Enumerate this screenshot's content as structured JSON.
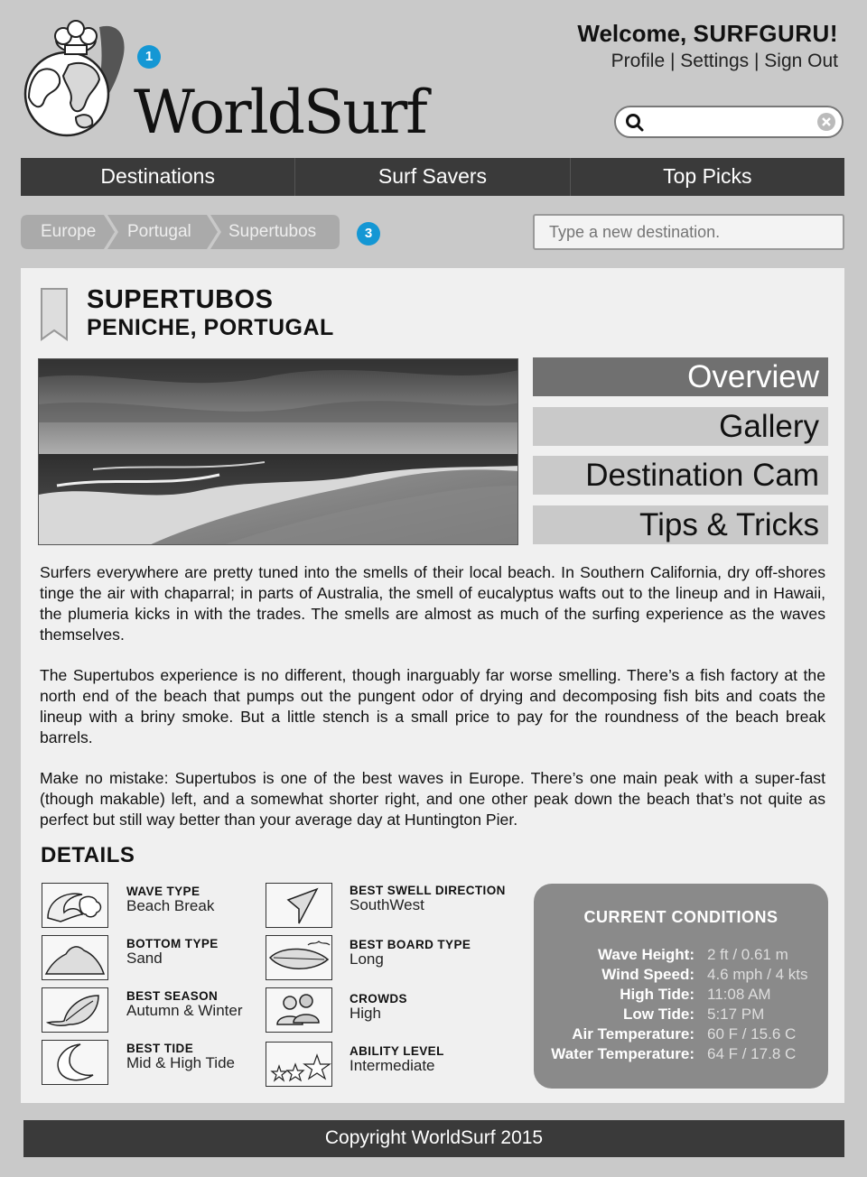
{
  "header": {
    "logo_text": "WorldSurf",
    "badge_1": "1",
    "welcome_prefix": "Welcome, ",
    "username": "SURFGURU!",
    "links": [
      "Profile",
      "Settings",
      "Sign Out"
    ],
    "link_separator": " | "
  },
  "nav": [
    "Destinations",
    "Surf Savers",
    "Top Picks"
  ],
  "breadcrumb": {
    "items": [
      "Europe",
      "Portugal",
      "Supertubos"
    ],
    "badge_3": "3"
  },
  "destination_input": {
    "placeholder": "Type a new destination."
  },
  "spot": {
    "name": "SUPERTUBOS",
    "location": "PENICHE, PORTUGAL"
  },
  "tabs": [
    "Overview",
    "Gallery",
    "Destination Cam",
    "Tips & Tricks"
  ],
  "active_tab": "Overview",
  "description": [
    "Surfers everywhere are pretty tuned into the smells of their local beach. In Southern California, dry off-shores tinge the air with chaparral; in parts of Australia, the smell of eucalyptus wafts out to the lineup and in Hawaii, the plumeria kicks in with the trades. The smells are almost as much of the surfing experience as the waves themselves.",
    "The Supertubos experience is no different, though inarguably far worse smelling. There’s a fish factory at the north end of the beach that pumps out the pungent odor of drying and decomposing fish bits and coats the lineup with a briny smoke. But a little stench is a small price to pay for the roundness of the beach break barrels.",
    "Make no mistake: Supertubos is one of the best waves in Europe. There’s one main peak with a super-fast (though makable) left, and a somewhat shorter right, and one other peak down the beach that’s not quite as perfect but still way better than your average day at Huntington Pier."
  ],
  "details": {
    "heading": "DETAILS",
    "left": [
      {
        "label": "WAVE TYPE",
        "value": "Beach Break",
        "icon": "wave-icon"
      },
      {
        "label": "BOTTOM TYPE",
        "value": "Sand",
        "icon": "sand-icon"
      },
      {
        "label": "BEST SEASON",
        "value": "Autumn & Winter",
        "icon": "leaf-icon"
      },
      {
        "label": "BEST TIDE",
        "value": "Mid & High Tide",
        "icon": "moon-icon"
      }
    ],
    "right": [
      {
        "label": "BEST SWELL DIRECTION",
        "value": "SouthWest",
        "icon": "direction-arrow-icon"
      },
      {
        "label": "BEST BOARD TYPE",
        "value": "Long",
        "icon": "surfboard-icon"
      },
      {
        "label": "CROWDS",
        "value": "High",
        "icon": "people-icon"
      },
      {
        "label": "ABILITY LEVEL",
        "value": "Intermediate",
        "icon": "stars-icon"
      }
    ]
  },
  "conditions": {
    "title": "CURRENT CONDITIONS",
    "rows": [
      {
        "label": "Wave Height:",
        "value": "2 ft / 0.61 m"
      },
      {
        "label": "Wind Speed:",
        "value": "4.6 mph / 4 kts"
      },
      {
        "label": "High Tide:",
        "value": "11:08 AM"
      },
      {
        "label": "Low Tide:",
        "value": "5:17 PM"
      },
      {
        "label": "Air Temperature:",
        "value": "60 F / 15.6 C"
      },
      {
        "label": "Water Temperature:",
        "value": "64 F / 17.8 C"
      }
    ]
  },
  "footer": {
    "text": "Copyright WorldSurf 2015"
  }
}
